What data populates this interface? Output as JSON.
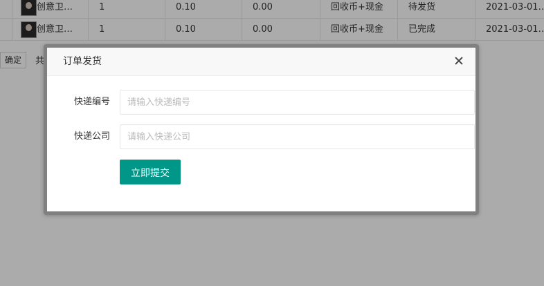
{
  "table": {
    "rows": [
      {
        "product": "创意卫…",
        "qty": "1",
        "price": "0.10",
        "amount": "0.00",
        "payment": "回收币+现金",
        "status": "待发货",
        "date": "2021-03-01…"
      },
      {
        "product": "创意卫…",
        "qty": "1",
        "price": "0.10",
        "amount": "0.00",
        "payment": "回收币+现金",
        "status": "已完成",
        "date": "2021-03-01…"
      }
    ]
  },
  "pager": {
    "confirm_label": "确定",
    "total_label": "共"
  },
  "dialog": {
    "title": "订单发货",
    "close_icon": "close-icon",
    "fields": {
      "tracking_number": {
        "label": "快递编号",
        "placeholder": "请输入快递编号",
        "value": ""
      },
      "courier_company": {
        "label": "快递公司",
        "placeholder": "请输入快递公司",
        "value": ""
      }
    },
    "submit_label": "立即提交"
  },
  "colors": {
    "primary_button": "#009688",
    "overlay": "rgba(0,0,0,0.33)"
  }
}
